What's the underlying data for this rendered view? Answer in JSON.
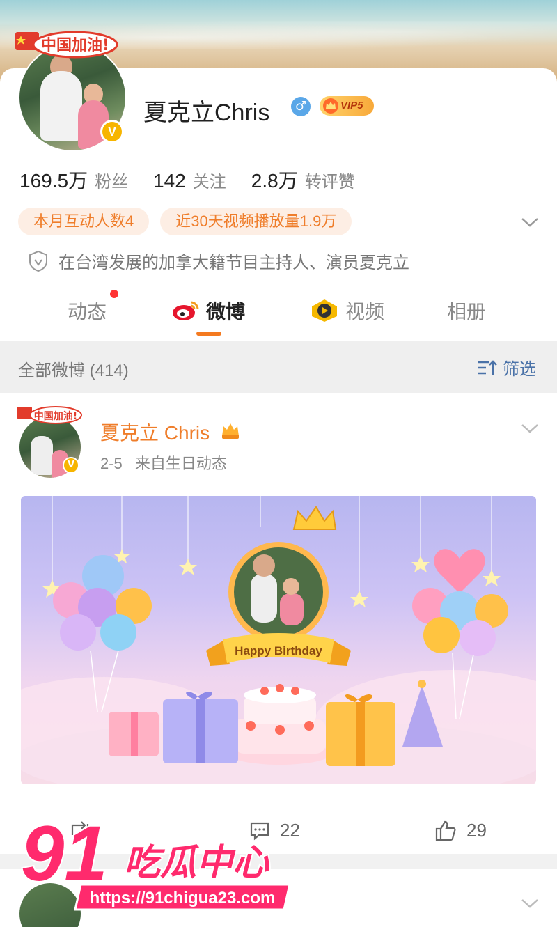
{
  "profile": {
    "cheer_text": "中国加油!",
    "verified_badge": "V",
    "name": "夏克立Chris",
    "gender_icon": "male-icon",
    "vip_label": "VIP5",
    "stats": [
      {
        "num": "169.5万",
        "label": "粉丝"
      },
      {
        "num": "142",
        "label": "关注"
      },
      {
        "num": "2.8万",
        "label": "转评赞"
      }
    ],
    "chips": [
      "本月互动人数4",
      "近30天视频播放量1.9万"
    ],
    "bio": "在台湾发展的加拿大籍节目主持人、演员夏克立"
  },
  "tabs": [
    {
      "label": "动态",
      "active": false,
      "has_dot": true
    },
    {
      "label": "微博",
      "active": true
    },
    {
      "label": "视频",
      "active": false
    },
    {
      "label": "相册",
      "active": false
    }
  ],
  "filter": {
    "title": "全部微博 (414)",
    "button": "筛选"
  },
  "post": {
    "cheer_text": "中国加油!",
    "verified_badge": "V",
    "author": "夏克立 Chris",
    "date": "2-5",
    "source": "来自生日动态",
    "banner_text": "Happy Birthday",
    "actions": {
      "repost": "",
      "comments": "22",
      "likes": "29"
    }
  },
  "watermark": {
    "number": "91",
    "name": "吃瓜中心",
    "url": "https://91chigua23.com"
  },
  "colors": {
    "accent": "#f47a20",
    "brand_orange": "#ef7d2a",
    "link_blue": "#4a72a8",
    "vip_gold": "#f8a93a",
    "watermark_pink": "#ff2a6d"
  }
}
